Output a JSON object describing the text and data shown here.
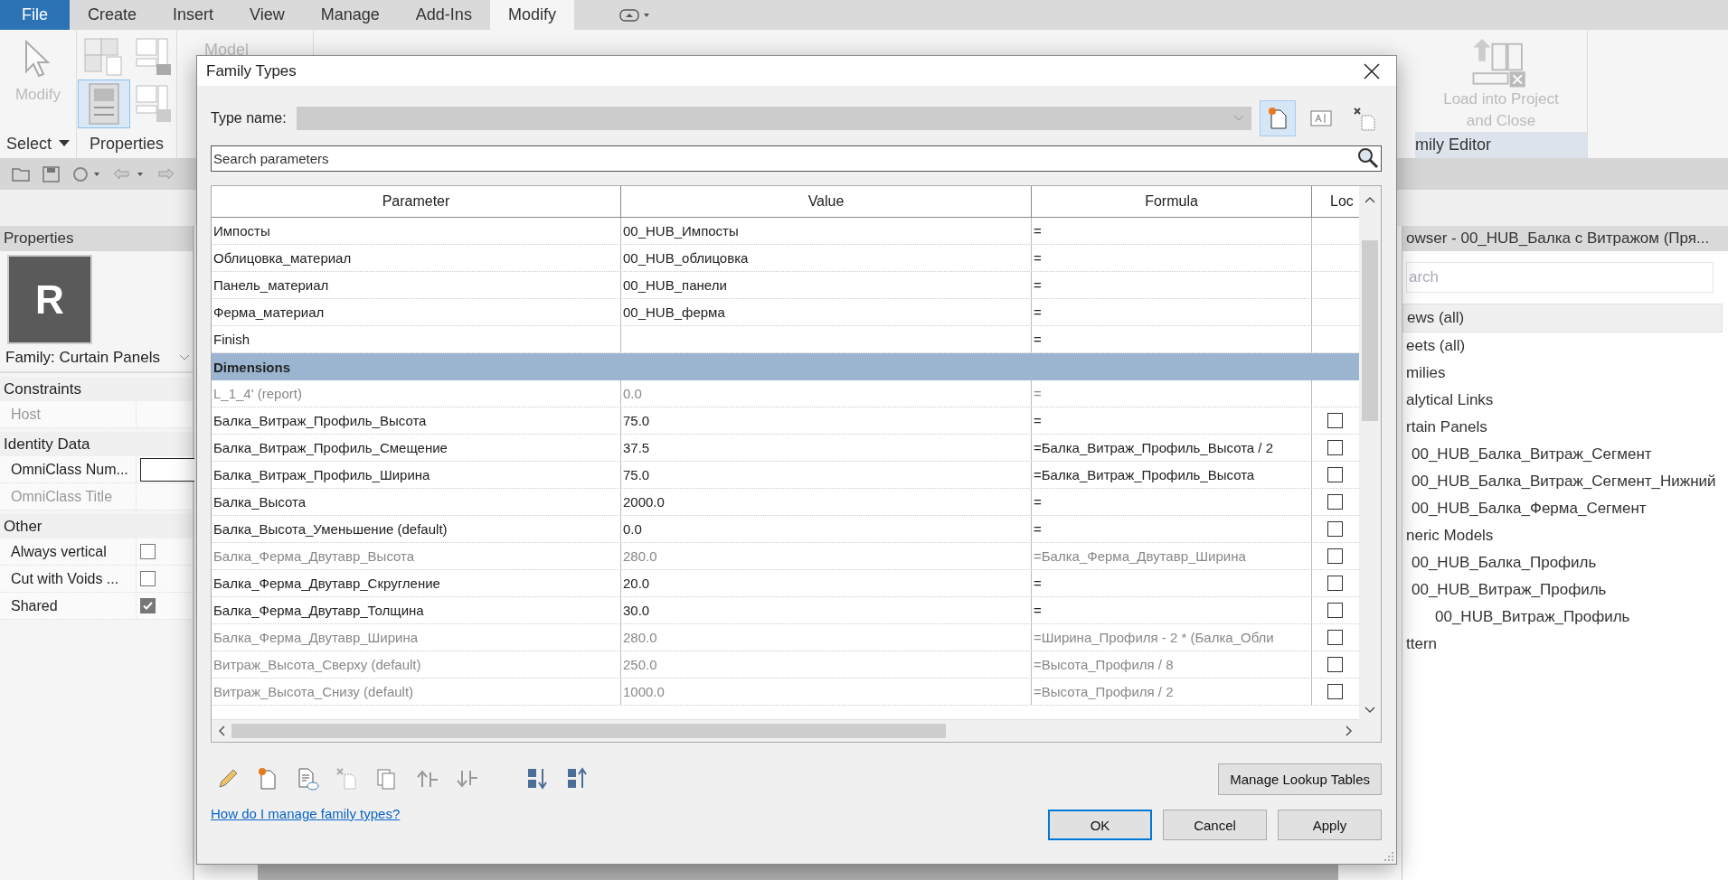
{
  "app_tabs": [
    {
      "label": "File",
      "kind": "file",
      "selected": false
    },
    {
      "label": "Create",
      "kind": "tab",
      "selected": false
    },
    {
      "label": "Insert",
      "kind": "tab",
      "selected": false
    },
    {
      "label": "View",
      "kind": "tab",
      "selected": false
    },
    {
      "label": "Manage",
      "kind": "tab",
      "selected": false
    },
    {
      "label": "Add-Ins",
      "kind": "tab",
      "selected": false
    },
    {
      "label": "Modify",
      "kind": "tab",
      "selected": true
    }
  ],
  "ribbon": {
    "modify_label": "Modify",
    "model_label": "Model",
    "select_label": "Select",
    "properties_label": "Properties",
    "load_label": "Load into Project and Close",
    "family_editor_label": "mily Editor"
  },
  "properties": {
    "title": "Properties",
    "logo_letter": "R",
    "family": "Family: Curtain Panels",
    "groups": [
      {
        "name": "Constraints",
        "rows": [
          {
            "label": "Host",
            "kind": "text",
            "disabled": true
          }
        ]
      },
      {
        "name": "Identity Data",
        "rows": [
          {
            "label": "OmniClass Num...",
            "kind": "field",
            "disabled": false
          },
          {
            "label": "OmniClass Title",
            "kind": "text",
            "disabled": true
          }
        ]
      },
      {
        "name": "Other",
        "rows": [
          {
            "label": "Always vertical",
            "kind": "checkbox",
            "disabled": false,
            "checked": false
          },
          {
            "label": "Cut with Voids ...",
            "kind": "checkbox",
            "disabled": false,
            "checked": false
          },
          {
            "label": "Shared",
            "kind": "checkbox",
            "disabled": false,
            "checked": true
          }
        ]
      }
    ]
  },
  "browser": {
    "title": "owser - 00_HUB_Балка с Витражом (Пря...",
    "search_placeholder": "arch",
    "items": [
      {
        "label": "ews (all)",
        "selected": true
      },
      {
        "label": "eets (all)",
        "selected": false
      },
      {
        "label": "milies",
        "selected": false
      },
      {
        "label": "alytical Links",
        "selected": false
      },
      {
        "label": "rtain Panels",
        "selected": false,
        "children": [
          {
            "label": "00_HUB_Балка_Витраж_Сегмент",
            "selected": false
          },
          {
            "label": "00_HUB_Балка_Витраж_Сегмент_Нижний",
            "selected": false
          },
          {
            "label": "00_HUB_Балка_Ферма_Сегмент",
            "selected": false
          }
        ]
      },
      {
        "label": "neric Models",
        "selected": false,
        "children": [
          {
            "label": "00_HUB_Балка_Профиль",
            "selected": false
          },
          {
            "label": "00_HUB_Витраж_Профиль",
            "selected": false,
            "children": [
              {
                "label": "00_HUB_Витраж_Профиль",
                "selected": false
              }
            ]
          }
        ]
      },
      {
        "label": "ttern",
        "selected": false
      }
    ]
  },
  "dialog": {
    "title": "Family Types",
    "type_name_label": "Type name:",
    "search_placeholder": "Search parameters",
    "columns": [
      "Parameter",
      "Value",
      "Formula",
      "Loc"
    ],
    "rows": [
      {
        "kind": "param",
        "parameter": "Импосты",
        "value": "00_HUB_Импосты",
        "formula": "=",
        "disabled": false
      },
      {
        "kind": "param",
        "parameter": "Облицовка_материал",
        "value": "00_HUB_облицовка",
        "formula": "=",
        "disabled": false
      },
      {
        "kind": "param",
        "parameter": "Панель_материал",
        "value": "00_HUB_панели",
        "formula": "=",
        "disabled": false
      },
      {
        "kind": "param",
        "parameter": "Ферма_материал",
        "value": "00_HUB_ферма",
        "formula": "=",
        "disabled": false
      },
      {
        "kind": "param",
        "parameter": "Finish",
        "formula": "=",
        "disabled": false
      },
      {
        "kind": "group",
        "label": "Dimensions"
      },
      {
        "kind": "param",
        "parameter": "L_1_4' (report)",
        "value": "0.0",
        "formula": "=",
        "disabled": true
      },
      {
        "kind": "param",
        "parameter": "Балка_Витраж_Профиль_Высота",
        "value": "75.0",
        "formula": "=",
        "disabled": false,
        "locked": false
      },
      {
        "kind": "param",
        "parameter": "Балка_Витраж_Профиль_Смещение",
        "value": "37.5",
        "formula": "=Балка_Витраж_Профиль_Высота / 2",
        "disabled": false,
        "locked": false
      },
      {
        "kind": "param",
        "parameter": "Балка_Витраж_Профиль_Ширина",
        "value": "75.0",
        "formula": "=Балка_Витраж_Профиль_Высота",
        "disabled": false,
        "locked": false
      },
      {
        "kind": "param",
        "parameter": "Балка_Высота",
        "value": "2000.0",
        "formula": "=",
        "disabled": false,
        "locked": false
      },
      {
        "kind": "param",
        "parameter": "Балка_Высота_Уменьшение (default)",
        "value": "0.0",
        "formula": "=",
        "disabled": false,
        "locked": false
      },
      {
        "kind": "param",
        "parameter": "Балка_Ферма_Двутавр_Высота",
        "value": "280.0",
        "formula": "=Балка_Ферма_Двутавр_Ширина",
        "disabled": true,
        "locked": false
      },
      {
        "kind": "param",
        "parameter": "Балка_Ферма_Двутавр_Скругление",
        "value": "20.0",
        "formula": "=",
        "disabled": false,
        "locked": false
      },
      {
        "kind": "param",
        "parameter": "Балка_Ферма_Двутавр_Толщина",
        "value": "30.0",
        "formula": "=",
        "disabled": false,
        "locked": false
      },
      {
        "kind": "param",
        "parameter": "Балка_Ферма_Двутавр_Ширина",
        "value": "280.0",
        "formula": "=Ширина_Профиля - 2 * (Балка_Обли",
        "disabled": true,
        "locked": false
      },
      {
        "kind": "param",
        "parameter": "Витраж_Высота_Сверху (default)",
        "value": "250.0",
        "formula": "=Высота_Профиля / 8",
        "disabled": true,
        "locked": false
      },
      {
        "kind": "param",
        "parameter": "Витраж_Высота_Снизу (default)",
        "value": "1000.0",
        "formula": "=Высота_Профиля / 2",
        "disabled": true,
        "locked": false
      }
    ],
    "lookup_button": "Manage Lookup Tables",
    "help_link": "How do I manage family types?",
    "buttons": [
      {
        "label": "OK",
        "kind": "default"
      },
      {
        "label": "Cancel",
        "kind": "normal"
      },
      {
        "label": "Apply",
        "kind": "normal"
      }
    ]
  }
}
